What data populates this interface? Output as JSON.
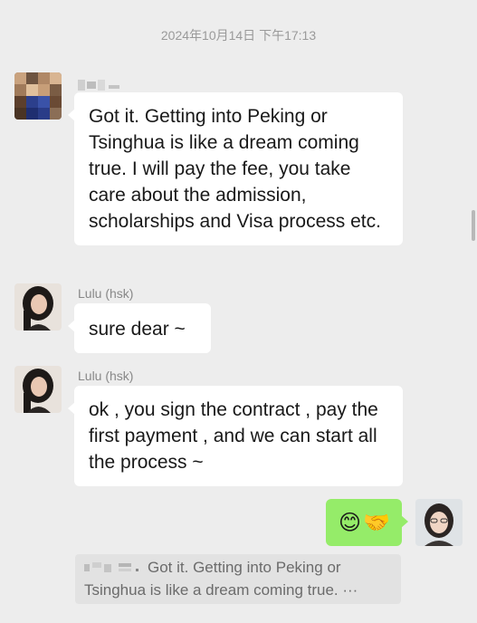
{
  "chat": {
    "timestamp": "2024年10月14日 下午17:13",
    "messages": [
      {
        "sender": "",
        "sender_obscured": true,
        "text": "Got it. Getting into Peking or Tsinghua is like a dream coming true. I will pay the fee, you take care about the admission, scholarships and Visa process etc."
      },
      {
        "sender": "Lulu (hsk)",
        "text": "sure dear ~"
      },
      {
        "sender": "Lulu (hsk)",
        "text": "ok , you sign the contract ,  pay the first payment , and we can start all the process ~"
      },
      {
        "sender": "me",
        "text": "😊🤝",
        "quote": {
          "quoted_sender_obscured": true,
          "text": "Got it. Getting into Peking or Tsinghua is like a dream coming true. ···"
        }
      }
    ]
  },
  "colors": {
    "background": "#ededed",
    "bubble_incoming": "#ffffff",
    "bubble_outgoing": "#95ec69",
    "quote_bg": "#e2e2e2"
  }
}
